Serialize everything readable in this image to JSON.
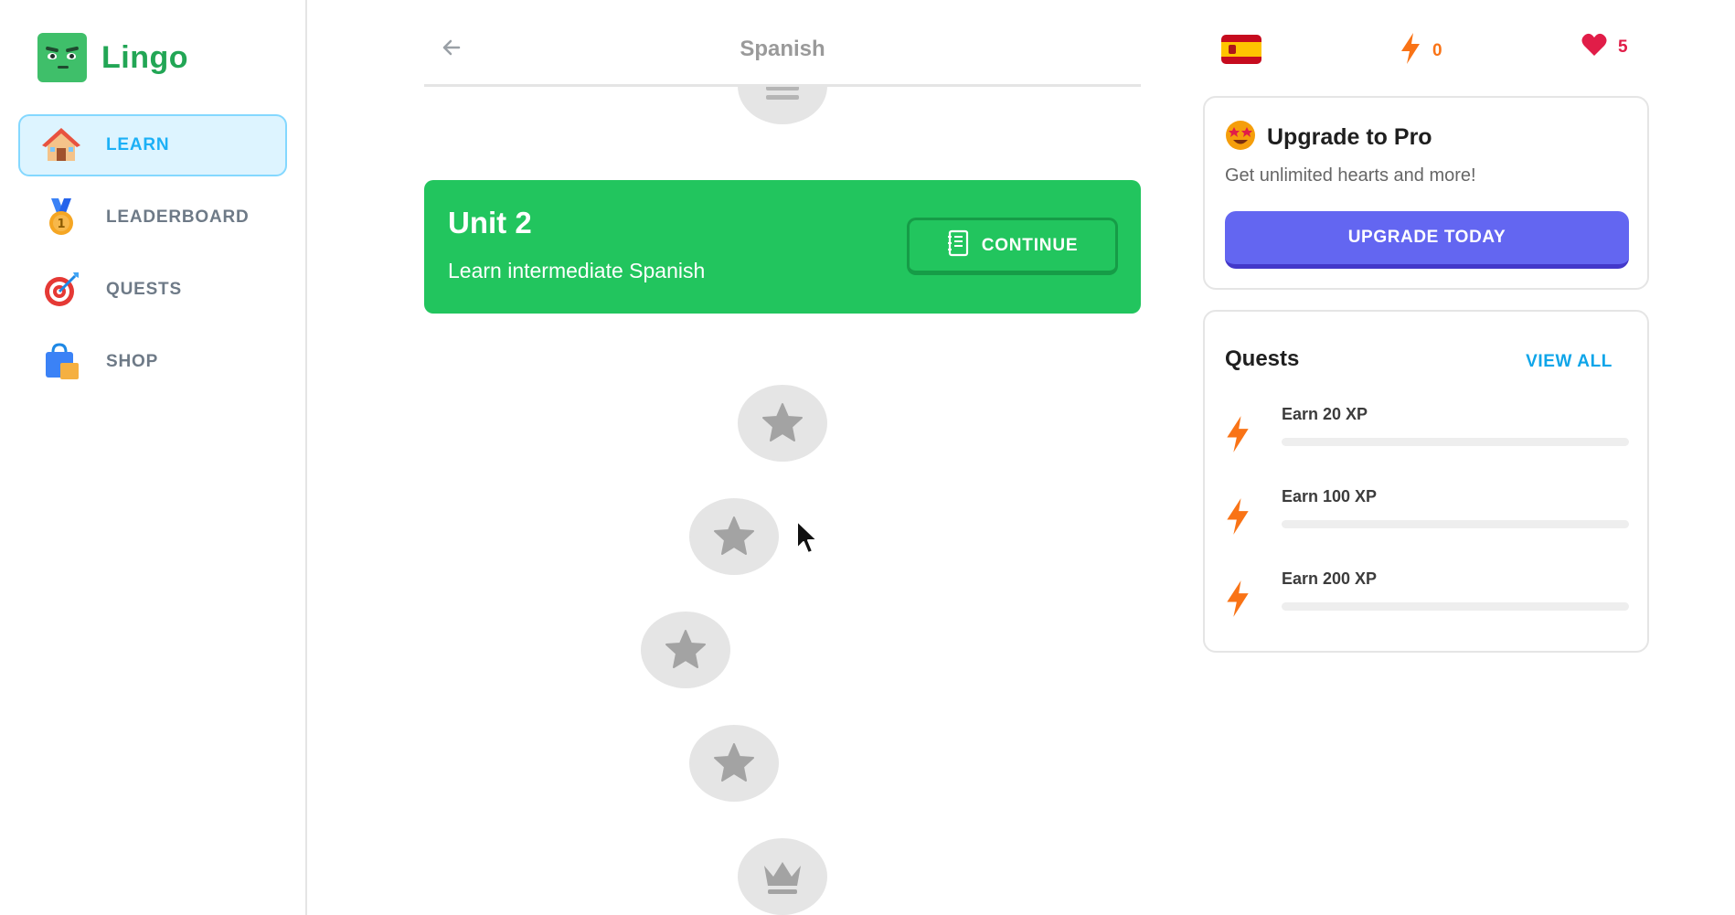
{
  "app": {
    "name": "Lingo"
  },
  "sidebar": {
    "items": [
      {
        "label": "LEARN",
        "icon": "house-icon",
        "active": true
      },
      {
        "label": "LEADERBOARD",
        "icon": "medal-icon",
        "active": false
      },
      {
        "label": "QUESTS",
        "icon": "target-icon",
        "active": false
      },
      {
        "label": "SHOP",
        "icon": "shopping-bag-icon",
        "active": false
      }
    ]
  },
  "header": {
    "title": "Spanish",
    "back_icon": "arrow-left-icon"
  },
  "unit": {
    "title": "Unit 2",
    "description": "Learn intermediate Spanish",
    "continue_label": "CONTINUE",
    "continue_icon": "notebook-icon"
  },
  "lessons": [
    {
      "icon": "list-icon",
      "locked": true
    },
    {
      "icon": "star-icon",
      "locked": true
    },
    {
      "icon": "star-icon",
      "locked": true
    },
    {
      "icon": "star-icon",
      "locked": true
    },
    {
      "icon": "star-icon",
      "locked": true
    },
    {
      "icon": "crown-icon",
      "locked": true
    }
  ],
  "stats": {
    "course_flag": "spain-flag-icon",
    "streak": "0",
    "hearts": "5"
  },
  "pro": {
    "title": "Upgrade to Pro",
    "subtitle": "Get unlimited hearts and more!",
    "button_label": "UPGRADE TODAY"
  },
  "quests": {
    "title": "Quests",
    "view_all": "VIEW ALL",
    "items": [
      {
        "label": "Earn 20 XP",
        "progress": 0
      },
      {
        "label": "Earn 100 XP",
        "progress": 0
      },
      {
        "label": "Earn 200 XP",
        "progress": 0
      }
    ]
  },
  "colors": {
    "brand": "#22a655",
    "unit_banner": "#22c55e",
    "active_nav_bg": "#ddf4ff",
    "active_nav_text": "#1cb0f6",
    "upgrade_button": "#6366f1",
    "view_all": "#0ea5e9",
    "streak": "#f97316",
    "hearts": "#e11d48"
  }
}
